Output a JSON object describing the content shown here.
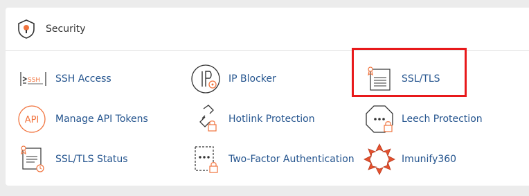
{
  "section": {
    "title": "Security",
    "icon": "shield-icon"
  },
  "items": [
    {
      "label": "SSH Access",
      "icon": "ssh-terminal-icon"
    },
    {
      "label": "IP Blocker",
      "icon": "ip-blocker-icon"
    },
    {
      "label": "SSL/TLS",
      "icon": "ssl-certificate-icon"
    },
    {
      "label": "Manage API Tokens",
      "icon": "api-icon"
    },
    {
      "label": "Hotlink Protection",
      "icon": "broken-chain-lock-icon"
    },
    {
      "label": "Leech Protection",
      "icon": "octagon-password-icon"
    },
    {
      "label": "SSL/TLS Status",
      "icon": "ssl-status-icon"
    },
    {
      "label": "Two-Factor Authentication",
      "icon": "two-factor-lock-icon"
    },
    {
      "label": "Imunify360",
      "icon": "imunify360-icon"
    }
  ],
  "colors": {
    "link": "#24548e",
    "accent": "#f1733d",
    "highlight": "#e8191b"
  }
}
